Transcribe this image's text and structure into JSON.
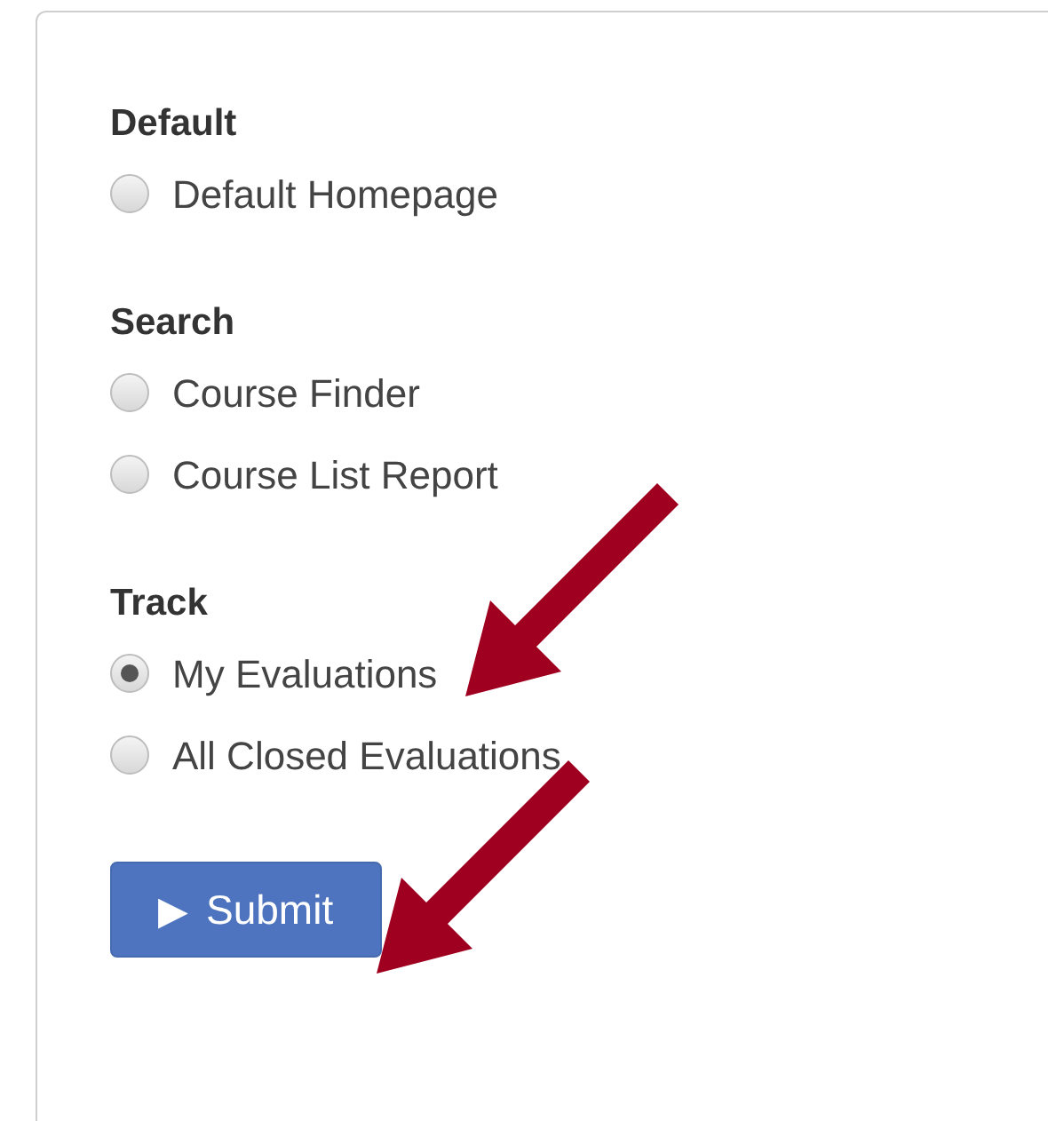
{
  "groups": [
    {
      "heading": "Default",
      "options": [
        {
          "label": "Default Homepage",
          "selected": false
        }
      ]
    },
    {
      "heading": "Search",
      "options": [
        {
          "label": "Course Finder",
          "selected": false
        },
        {
          "label": "Course List Report",
          "selected": false
        }
      ]
    },
    {
      "heading": "Track",
      "options": [
        {
          "label": "My Evaluations",
          "selected": true
        },
        {
          "label": "All Closed Evaluations",
          "selected": false
        }
      ]
    }
  ],
  "submit": {
    "icon": "▶",
    "label": "Submit"
  }
}
